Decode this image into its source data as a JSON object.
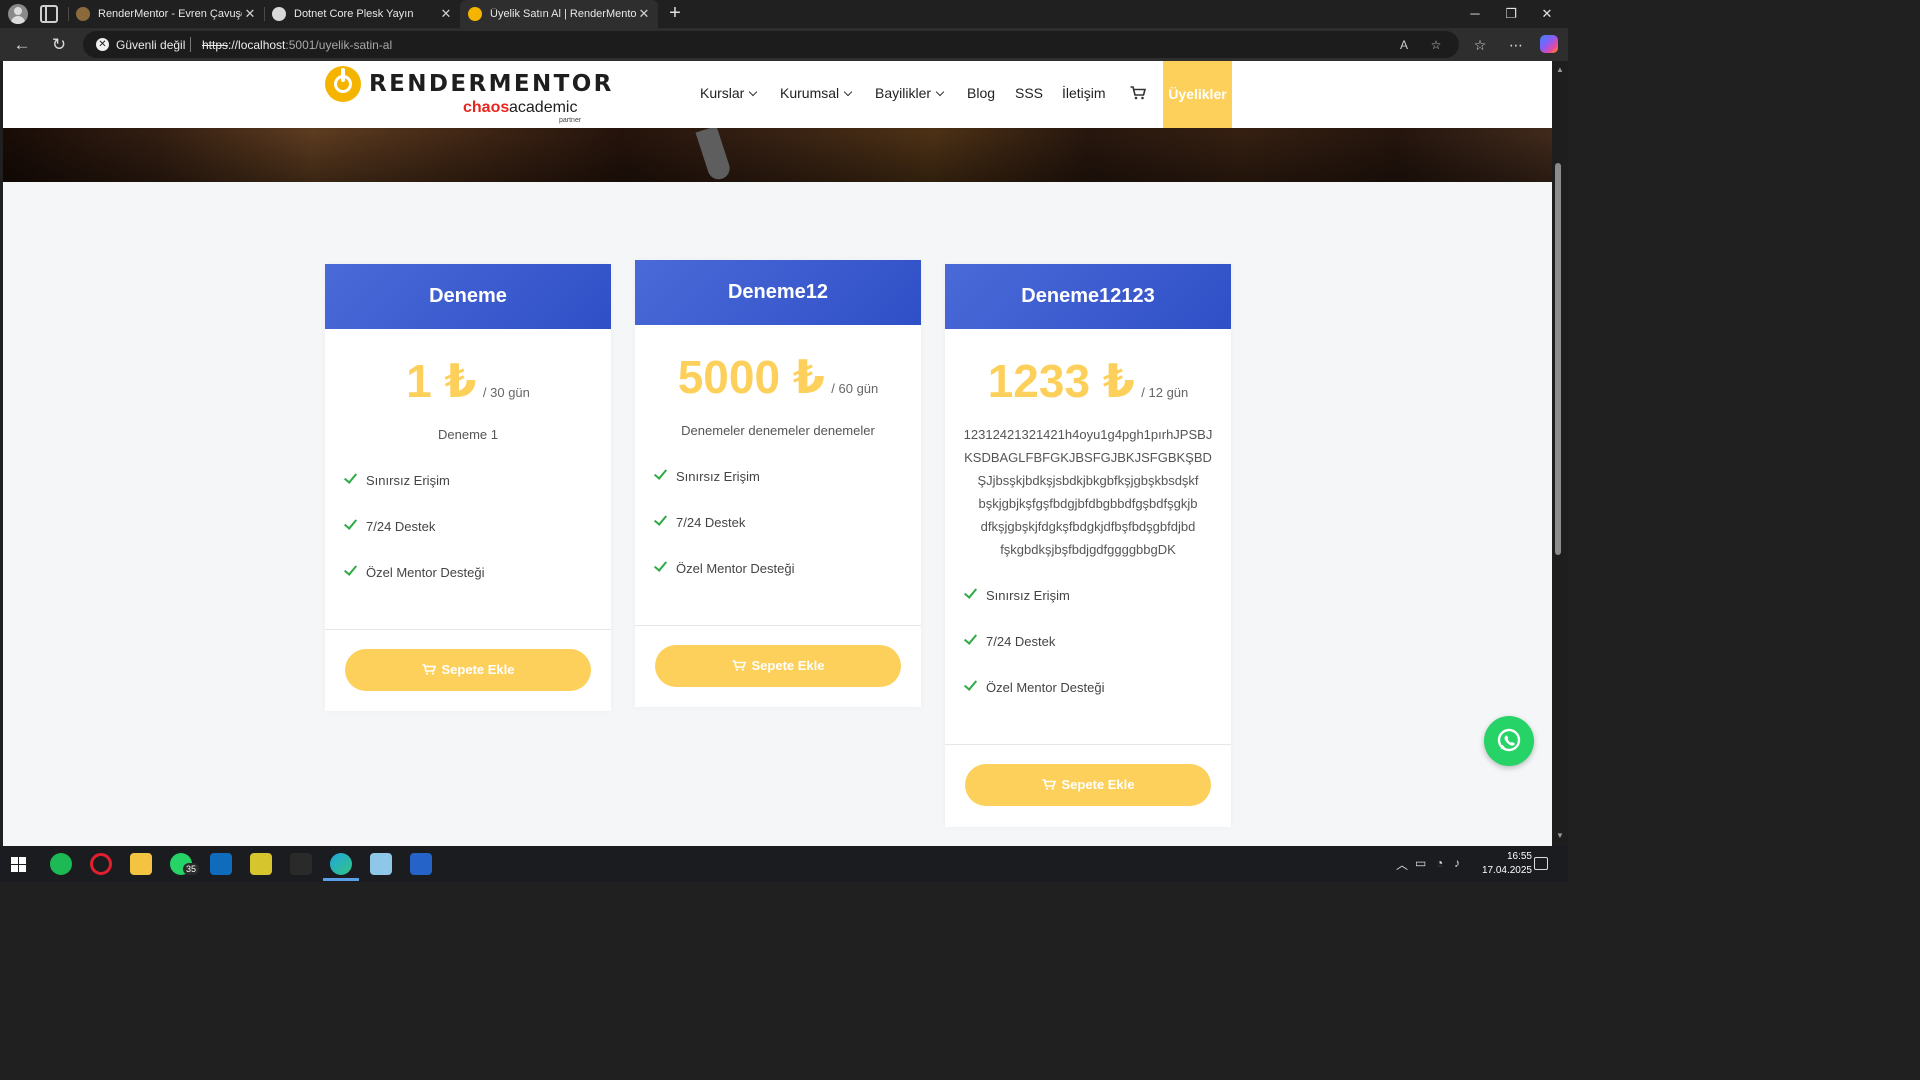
{
  "browser": {
    "tabs": [
      {
        "title": "RenderMentor - Evren Çavuşoğlu",
        "favicon_color": "#8a6a3a"
      },
      {
        "title": "Dotnet Core Plesk Yayın",
        "favicon_color": "#d8d8d8"
      },
      {
        "title": "Üyelik Satın Al | RenderMentor",
        "favicon_color": "#f4b400"
      }
    ],
    "active_tab_index": 2,
    "security_label": "Güvenli değil",
    "url": {
      "protocol": "https",
      "separator": "://",
      "host": "localhost",
      "path": ":5001/uyelik-satin-al"
    }
  },
  "site": {
    "logo": {
      "wordmark": "RENDERMENTOR",
      "partner_brand": "chaos",
      "partner_suffix": "academic",
      "partner_tag": "partner"
    },
    "nav": [
      {
        "label": "Kurslar",
        "has_dropdown": true
      },
      {
        "label": "Kurumsal",
        "has_dropdown": true
      },
      {
        "label": "Bayilikler",
        "has_dropdown": true
      },
      {
        "label": "Blog",
        "has_dropdown": false
      },
      {
        "label": "SSS",
        "has_dropdown": false
      },
      {
        "label": "İletişim",
        "has_dropdown": false
      }
    ],
    "cta": "Üyelikler",
    "accent_color": "#fcd05b",
    "header_color": "#2f4fc7"
  },
  "plans": [
    {
      "name": "Deneme",
      "price": "1 ₺",
      "period": "/ 30 gün",
      "description": "Deneme 1",
      "features": [
        "Sınırsız Erişim",
        "7/24 Destek",
        "Özel Mentor Desteği"
      ],
      "button": "Sepete Ekle"
    },
    {
      "name": "Deneme12",
      "price": "5000 ₺",
      "period": "/ 60 gün",
      "description": "Denemeler denemeler denemeler",
      "features": [
        "Sınırsız Erişim",
        "7/24 Destek",
        "Özel Mentor Desteği"
      ],
      "button": "Sepete Ekle"
    },
    {
      "name": "Deneme12123",
      "price": "1233 ₺",
      "period": "/ 12 gün",
      "description_lines": [
        "12312421321421h4oyu1g4pgh1pırhJPSBJ",
        "KSDBAGLFBFGKJBSFGJBKJSFGBKŞBD",
        "ŞJjbsşkjbdkşjsbdkjbkgbfkşjgbşkbsdşkf",
        "bşkjgbjkşfgşfbdgjbfdbgbbdfgşbdfşgkjb",
        "dfkşjgbşkjfdgkşfbdgkjdfbşfbdşgbfdjbd",
        "fşkgbdkşjbşfbdjgdfggggbbgDK"
      ],
      "features": [
        "Sınırsız Erişim",
        "7/24 Destek",
        "Özel Mentor Desteği"
      ],
      "button": "Sepete Ekle"
    }
  ],
  "taskbar": {
    "whatsapp_badge": "35",
    "time": "16:55",
    "date": "17.04.2025"
  }
}
